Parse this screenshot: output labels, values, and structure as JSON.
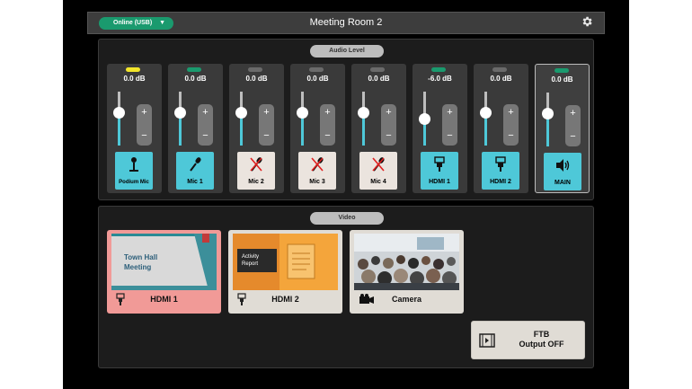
{
  "header": {
    "status": "Online (USB)",
    "room_title": "Meeting Room 2"
  },
  "audio": {
    "section_label": "Audio Level",
    "channels": [
      {
        "label": "Podium Mic",
        "db": "0.0 dB",
        "led": "#f2e52a",
        "level": 0.62,
        "on": true,
        "icon": "podium-mic-icon"
      },
      {
        "label": "Mic 1",
        "db": "0.0 dB",
        "led": "#1a9a6e",
        "level": 0.62,
        "on": true,
        "icon": "microphone-icon"
      },
      {
        "label": "Mic 2",
        "db": "0.0 dB",
        "led": "#6a6a6a",
        "level": 0.62,
        "on": false,
        "icon": "microphone-muted-icon"
      },
      {
        "label": "Mic 3",
        "db": "0.0 dB",
        "led": "#6a6a6a",
        "level": 0.62,
        "on": false,
        "icon": "microphone-muted-icon"
      },
      {
        "label": "Mic 4",
        "db": "0.0 dB",
        "led": "#6a6a6a",
        "level": 0.62,
        "on": false,
        "icon": "microphone-muted-icon"
      },
      {
        "label": "HDMI 1",
        "db": "-6.0 dB",
        "led": "#1a9a6e",
        "level": 0.5,
        "on": true,
        "icon": "hdmi-icon"
      },
      {
        "label": "HDMI 2",
        "db": "0.0 dB",
        "led": "#6a6a6a",
        "level": 0.62,
        "on": true,
        "icon": "hdmi-icon"
      },
      {
        "label": "MAIN",
        "db": "0.0 dB",
        "led": "#1a9a6e",
        "level": 0.62,
        "on": true,
        "icon": "speaker-icon"
      }
    ]
  },
  "video": {
    "section_label": "Video",
    "sources": [
      {
        "label": "HDMI 1",
        "active": true,
        "icon": "hdmi-icon",
        "thumb_text": [
          "Town Hall",
          "Meeting"
        ]
      },
      {
        "label": "HDMI 2",
        "active": false,
        "icon": "hdmi-icon",
        "thumb_text": [
          "Activity",
          "Report"
        ]
      },
      {
        "label": "Camera",
        "active": false,
        "icon": "camera-icon",
        "thumb_text": []
      }
    ],
    "ftb": {
      "line1": "FTB",
      "line2": "Output OFF"
    }
  },
  "colors": {
    "accent_cyan": "#4ec8d8",
    "online_green": "#1a9a6e",
    "active_source": "#f19a97"
  }
}
